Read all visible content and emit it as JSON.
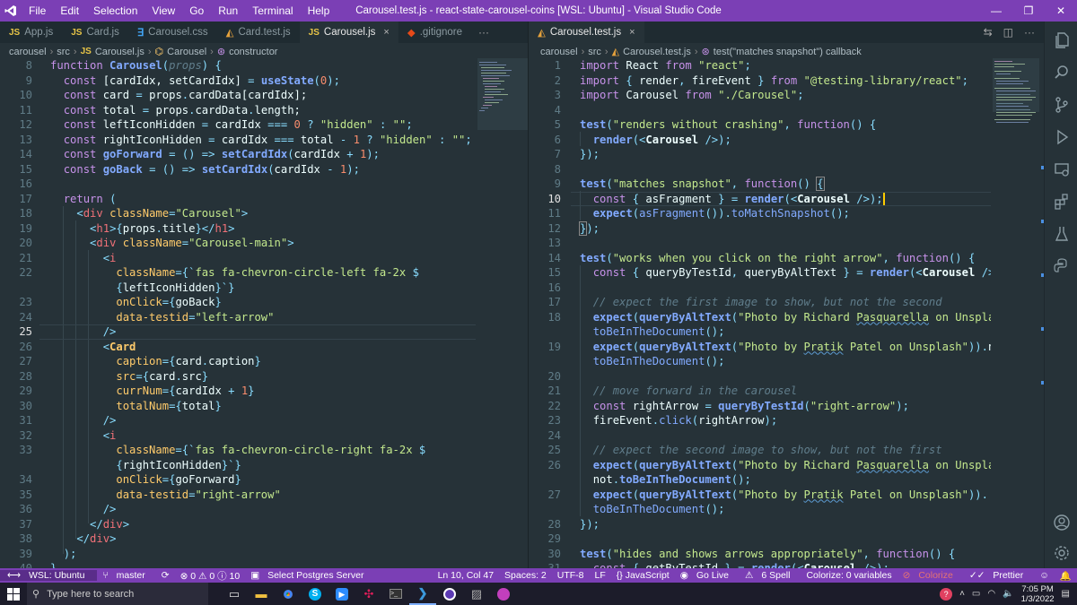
{
  "titlebar": {
    "menu": [
      "File",
      "Edit",
      "Selection",
      "View",
      "Go",
      "Run",
      "Terminal",
      "Help"
    ],
    "title": "Carousel.test.js - react-state-carousel-coins [WSL: Ubuntu] - Visual Studio Code"
  },
  "left_tabs": [
    {
      "badge": "JS",
      "label": "App.js"
    },
    {
      "badge": "JS",
      "label": "Card.js"
    },
    {
      "badge": "css",
      "label": "Carousel.css"
    },
    {
      "badge": "react",
      "label": "Card.test.js"
    },
    {
      "badge": "JS",
      "label": "Carousel.js",
      "close": "×"
    },
    {
      "badge": "git",
      "label": ".gitignore"
    }
  ],
  "left_tabs_more": "···",
  "right_tab": {
    "label": "Carousel.test.js",
    "close": "×"
  },
  "left_breadcrumb": [
    "carousel",
    "src",
    "Carousel.js",
    "Carousel",
    "constructor"
  ],
  "right_breadcrumb": [
    "carousel",
    "src",
    "Carousel.test.js",
    "test(\"matches snapshot\") callback"
  ],
  "left_line_numbers": [
    "8",
    "9",
    "10",
    "11",
    "12",
    "13",
    "14",
    "15",
    "16",
    "17",
    "18",
    "19",
    "20",
    "21",
    "22",
    "",
    "23",
    "24",
    "25",
    "26",
    "27",
    "28",
    "29",
    "30",
    "31",
    "32",
    "33",
    "",
    "34",
    "35",
    "36",
    "37",
    "38",
    "39",
    "40"
  ],
  "right_line_numbers": [
    "1",
    "2",
    "3",
    "4",
    "5",
    "6",
    "7",
    "8",
    "9",
    "10",
    "11",
    "12",
    "13",
    "14",
    "15",
    "16",
    "17",
    "18",
    "",
    "19",
    "",
    "20",
    "21",
    "22",
    "23",
    "24",
    "25",
    "26",
    "",
    "27",
    "",
    "28",
    "29",
    "30",
    "31"
  ],
  "statusbar": {
    "remote": "WSL: Ubuntu",
    "branch": "master",
    "problems": "⊗ 0 ⚠ 0 ⓘ 10",
    "db": "Select Postgres Server",
    "position": "Ln 10, Col 47",
    "spaces": "Spaces: 2",
    "encoding": "UTF-8",
    "eol": "LF",
    "language": "{} JavaScript",
    "golive": "Go Live",
    "spell": "6 Spell",
    "colorize": "Colorize: 0 variables",
    "colorize2": "Colorize",
    "prettier": "Prettier"
  },
  "taskbar": {
    "search_placeholder": "Type here to search",
    "time": "7:05 PM",
    "date": "1/3/2022"
  },
  "colors": {
    "accent": "#7b3fb5",
    "editor_bg": "#263238"
  }
}
